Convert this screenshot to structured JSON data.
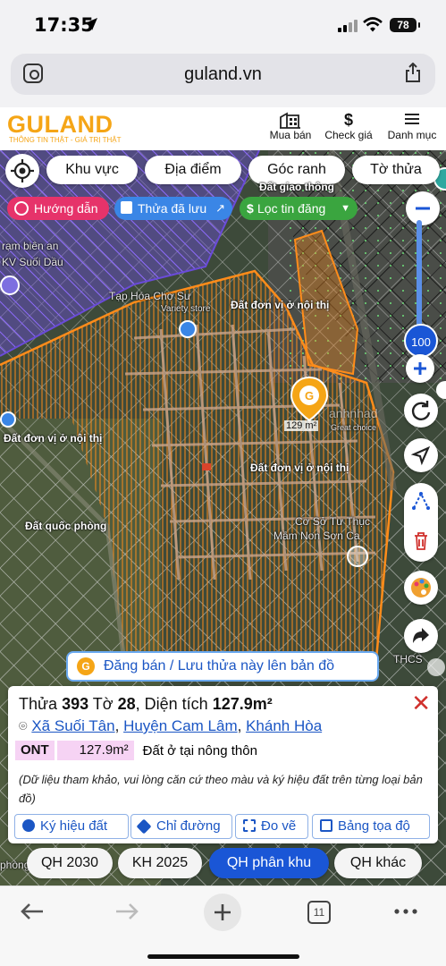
{
  "status": {
    "time": "17:35",
    "battery": "78"
  },
  "browser": {
    "url": "guland.vn",
    "tab_count": "11"
  },
  "header": {
    "logo": "GULAND",
    "tagline": "THÔNG TIN THẬT - GIÁ TRỊ THẬT",
    "nav": [
      {
        "label": "Mua bán",
        "icon": "building-icon"
      },
      {
        "label": "Check giá",
        "icon": "dollar-icon"
      },
      {
        "label": "Danh mục",
        "icon": "menu-icon"
      }
    ]
  },
  "map": {
    "filters": [
      "Khu vực",
      "Địa điểm",
      "Góc ranh",
      "Tờ thửa"
    ],
    "chips": {
      "guide": "Hướng dẫn",
      "saved": "Thửa đã lưu",
      "filter": "Lọc tin đăng"
    },
    "zoom_value": "100",
    "marker_area": "129 m²",
    "labels": {
      "giao_thong": "Đất giao thông",
      "tap_hoa": "Tạp Hóa Chợ Sư",
      "variety": "Variety store",
      "don_vi_top": "Đất đơn vị ở nội thị",
      "don_vi_left": "Đất đơn vị ở nội thị",
      "don_vi_mid": "Đất đơn vị ở nội thị",
      "quoc_phong": "Đất quốc phòng",
      "co_so": "Cơ Sở Tư Thục",
      "mam_non": "Mầm Non Sơn Ca",
      "bien_an": "rạm biên an",
      "kv": "KV Suối Dầu",
      "phong": "phòng",
      "thcs": "THCS",
      "great": "Great choice",
      "watermark": "anhnhad"
    },
    "post_button": "Đăng bán / Lưu thửa này lên bản đồ",
    "colors": {
      "parcel": "#ff8c1a",
      "purple_zone": "#7a4ff0",
      "accent": "#1a56d6",
      "brand": "#f5a516"
    }
  },
  "parcel": {
    "prefix_thua": "Thửa ",
    "thua": "393",
    "prefix_to": " Tờ ",
    "to": "28",
    "prefix_dt": ", Diện tích ",
    "area": "127.9m²",
    "commune": "Xã Suối Tân",
    "district": "Huyện Cam Lâm",
    "province": "Khánh Hòa",
    "land_code": "ONT",
    "land_area": "127.9m²",
    "land_desc": "Đất ở tại nông thôn",
    "note": "(Dữ liệu tham khảo, vui lòng căn cứ theo màu và ký hiệu đất trên từng loại bản đồ)",
    "tools": [
      "Ký hiệu đất",
      "Chỉ đường",
      "Đo vẽ",
      "Bảng tọa độ"
    ]
  },
  "plans": [
    "QH 2030",
    "KH 2025",
    "QH phân khu",
    "QH khác"
  ]
}
